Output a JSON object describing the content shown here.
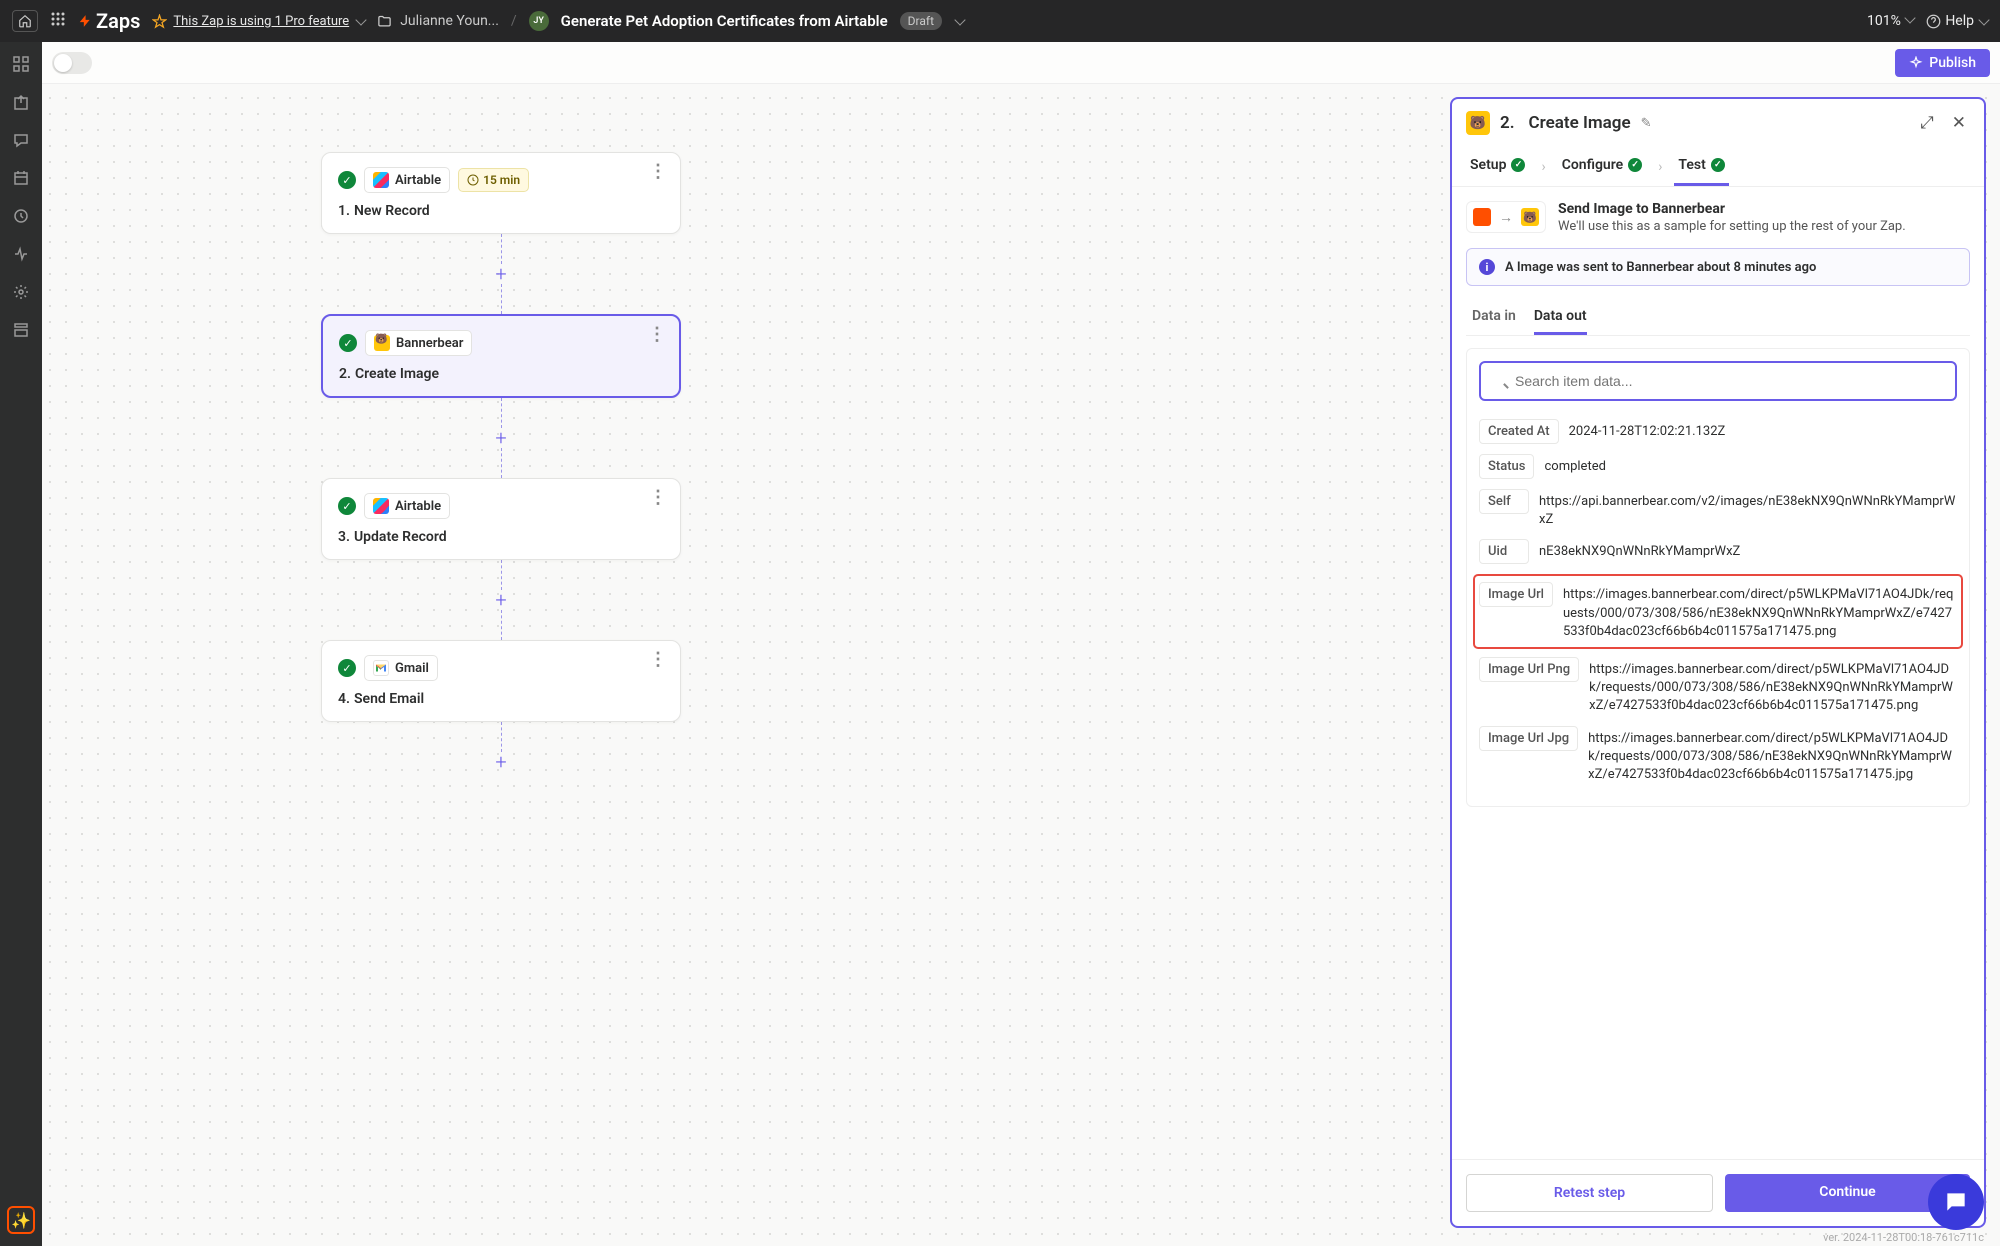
{
  "header": {
    "zaps_label": "Zaps",
    "pro_feature": "This Zap is using 1 Pro feature",
    "folder": "Julianne Youn...",
    "avatar_initials": "JY",
    "zap_title": "Generate Pet Adoption Certificates from Airtable",
    "draft_badge": "Draft",
    "zoom": "101%",
    "help": "Help"
  },
  "toolbar": {
    "publish": "Publish"
  },
  "steps": [
    {
      "app": "Airtable",
      "time": "15 min",
      "num": "1.",
      "title": "New Record"
    },
    {
      "app": "Bannerbear",
      "num": "2.",
      "title": "Create Image",
      "selected": true
    },
    {
      "app": "Airtable",
      "num": "3.",
      "title": "Update Record"
    },
    {
      "app": "Gmail",
      "num": "4.",
      "title": "Send Email"
    }
  ],
  "panel": {
    "num": "2.",
    "title": "Create Image",
    "tabs": {
      "setup": "Setup",
      "configure": "Configure",
      "test": "Test"
    },
    "send_heading": "Send Image to Bannerbear",
    "send_desc": "We'll use this as a sample for setting up the rest of your Zap.",
    "info_banner": "A Image was sent to Bannerbear about 8 minutes ago",
    "data_tabs": {
      "in": "Data in",
      "out": "Data out"
    },
    "search_placeholder": "Search item data...",
    "rows": {
      "created_at_label": "Created At",
      "created_at_value": "2024-11-28T12:02:21.132Z",
      "status_label": "Status",
      "status_value": "completed",
      "self_label": "Self",
      "self_value": "https://api.bannerbear.com/v2/images/nE38ekNX9QnWNnRkYMamprWxZ",
      "uid_label": "Uid",
      "uid_value": "nE38ekNX9QnWNnRkYMamprWxZ",
      "image_url_label": "Image Url",
      "image_url_value": "https://images.bannerbear.com/direct/p5WLKPMaVl71AO4JDk/requests/000/073/308/586/nE38ekNX9QnWNnRkYMamprWxZ/e7427533f0b4dac023cf66b6b4c011575a171475.png",
      "image_url_png_label": "Image Url Png",
      "image_url_png_value": "https://images.bannerbear.com/direct/p5WLKPMaVl71AO4JDk/requests/000/073/308/586/nE38ekNX9QnWNnRkYMamprWxZ/e7427533f0b4dac023cf66b6b4c011575a171475.png",
      "image_url_jpg_label": "Image Url Jpg",
      "image_url_jpg_value": "https://images.bannerbear.com/direct/p5WLKPMaVl71AO4JDk/requests/000/073/308/586/nE38ekNX9QnWNnRkYMamprWxZ/e7427533f0b4dac023cf66b6b4c011575a171475.jpg"
    },
    "footer": {
      "retest": "Retest step",
      "continue": "Continue"
    }
  },
  "version": "ver. 2024-11-28T00:18-761c711c"
}
